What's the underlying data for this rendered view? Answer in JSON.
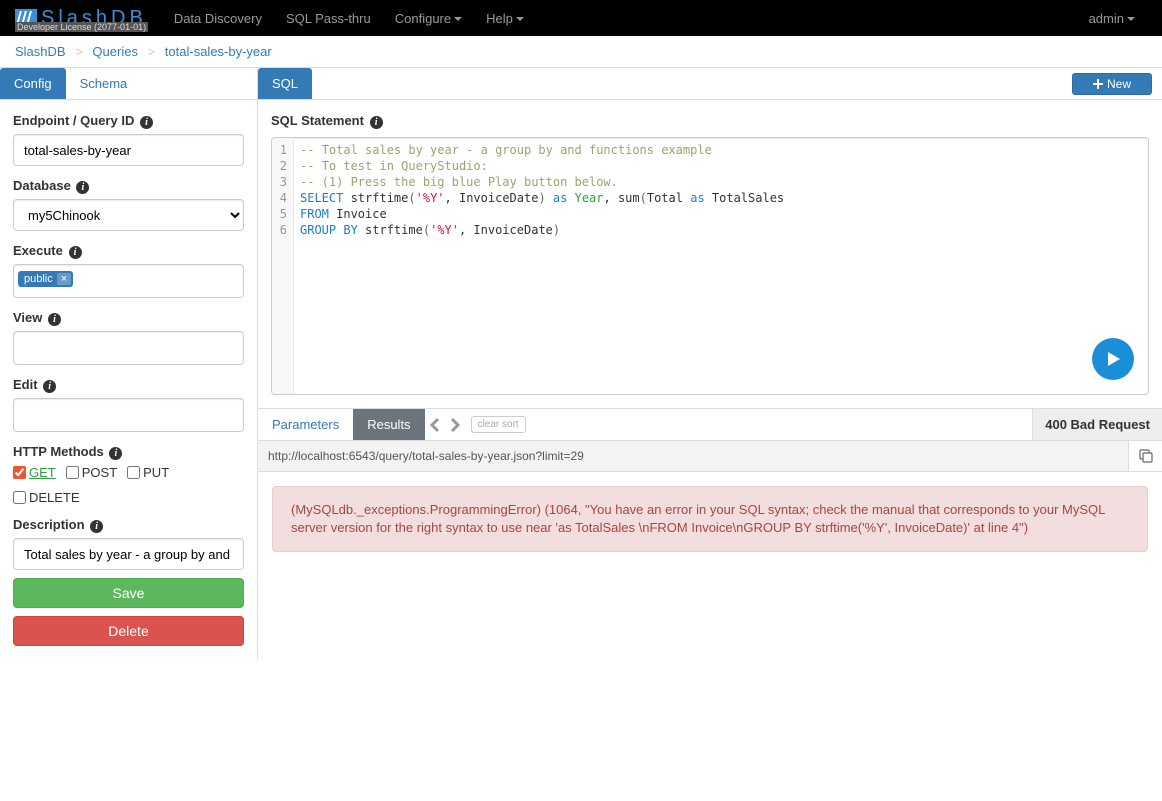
{
  "brand": {
    "name": "SlashDB",
    "license": "Developer License (2077-01-01)"
  },
  "nav": {
    "items": [
      "Data Discovery",
      "SQL Pass-thru",
      "Configure",
      "Help"
    ],
    "dropdown": [
      false,
      false,
      true,
      true
    ],
    "user": "admin"
  },
  "breadcrumb": {
    "a": "SlashDB",
    "b": "Queries",
    "c": "total-sales-by-year"
  },
  "sidebar": {
    "tabs": {
      "config": "Config",
      "schema": "Schema"
    },
    "endpoint_label": "Endpoint / Query ID",
    "endpoint_value": "total-sales-by-year",
    "database_label": "Database",
    "database_value": "my5Chinook",
    "execute_label": "Execute",
    "execute_tag": "public",
    "view_label": "View",
    "edit_label": "Edit",
    "http_label": "HTTP Methods",
    "http": {
      "get": "GET",
      "post": "POST",
      "put": "PUT",
      "delete": "DELETE"
    },
    "desc_label": "Description",
    "desc_value": "Total sales by year - a group by and functions example",
    "save": "Save",
    "delete": "Delete"
  },
  "content": {
    "sql_tab": "SQL",
    "new_btn": "New",
    "sql_title": "SQL Statement",
    "lines": [
      "1",
      "2",
      "3",
      "4",
      "5",
      "6"
    ],
    "code": {
      "l1": "-- Total sales by year - a group by and functions example",
      "l2": "-- To test in QueryStudio:",
      "l3": "-- (1) Press the big blue Play button below.",
      "l4a": "SELECT",
      "l4b": " strftime",
      "l4c": "(",
      "l4d": "'%Y'",
      "l4e": ", InvoiceDate",
      "l4f": ") ",
      "l4g": "as",
      "l4h": " ",
      "l4i": "Year",
      "l4j": ", sum",
      "l4k": "(",
      "l4l": "Total ",
      "l4m": "as",
      "l4n": " TotalSales",
      "l5a": "FROM",
      "l5b": " Invoice",
      "l6a": "GROUP BY",
      "l6b": " strftime",
      "l6c": "(",
      "l6d": "'%Y'",
      "l6e": ", InvoiceDate",
      "l6f": ")"
    },
    "result_tabs": {
      "params": "Parameters",
      "results": "Results"
    },
    "clear_sort": "clear sort",
    "status": "400 Bad Request",
    "url": "http://localhost:6543/query/total-sales-by-year.json?limit=29",
    "error": "(MySQLdb._exceptions.ProgrammingError) (1064, \"You have an error in your SQL syntax; check the manual that corresponds to your MySQL server version for the right syntax to use near 'as TotalSales \\nFROM Invoice\\nGROUP BY strftime('%Y', InvoiceDate)' at line 4\")"
  }
}
